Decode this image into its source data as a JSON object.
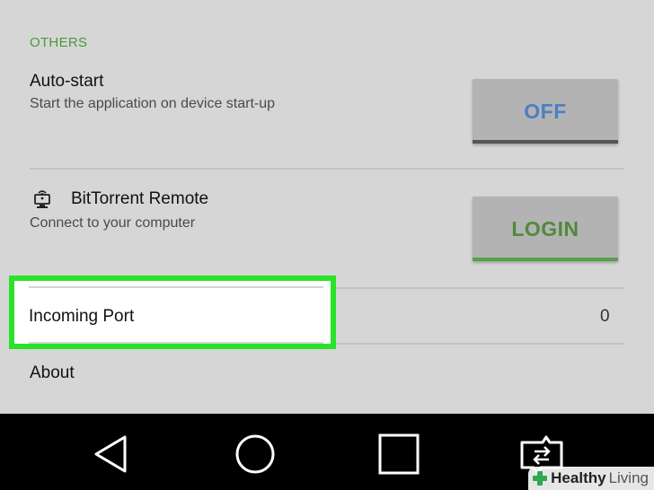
{
  "settings": {
    "section_header": "OTHERS",
    "auto_start": {
      "title": "Auto-start",
      "subtitle": "Start the application on device start-up",
      "button_label": "OFF"
    },
    "remote": {
      "icon": "remote-access-icon",
      "title": "BitTorrent Remote",
      "subtitle": "Connect to your computer",
      "button_label": "LOGIN"
    },
    "incoming_port": {
      "title": "Incoming Port",
      "value": "0"
    },
    "about": {
      "title": "About"
    }
  },
  "colors": {
    "highlight": "#29e229",
    "section_header": "#4a9a3a",
    "off_text": "#4a7fc4",
    "login_text": "#4f8a3c"
  },
  "nav_bar": {
    "icons": [
      "back-icon",
      "home-icon",
      "recents-icon",
      "screen-switch-icon"
    ]
  },
  "watermark": {
    "brand": "Healthy",
    "brand2": "Living"
  }
}
